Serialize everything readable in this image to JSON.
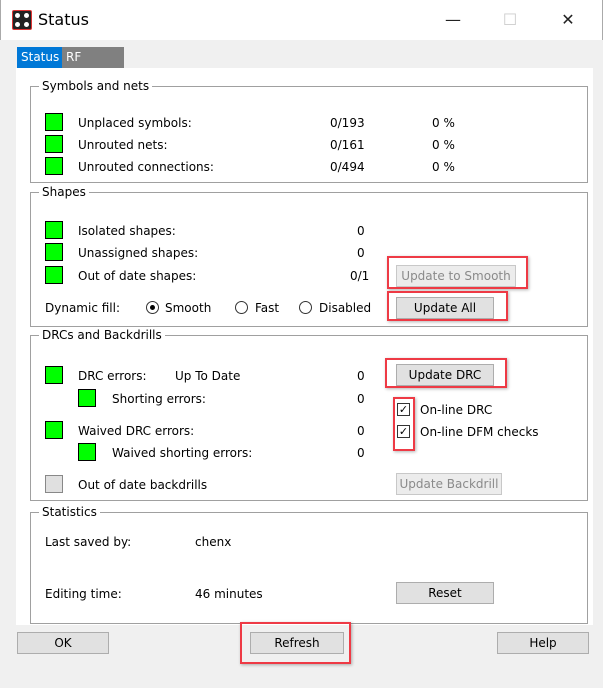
{
  "window": {
    "title": "Status",
    "icon": "pcb-app-icon",
    "minimize": "—",
    "maximize": "☐",
    "close": "✕"
  },
  "tabs": [
    {
      "label": "Status",
      "active": true
    },
    {
      "label": "RF Status",
      "active": false
    }
  ],
  "symbols_nets": {
    "title": "Symbols and nets",
    "rows": [
      {
        "label": "Unplaced symbols:",
        "value": "0/193",
        "percent": "0 %",
        "status": "#00ff00"
      },
      {
        "label": "Unrouted nets:",
        "value": "0/161",
        "percent": "0 %",
        "status": "#00ff00"
      },
      {
        "label": "Unrouted connections:",
        "value": "0/494",
        "percent": "0 %",
        "status": "#00ff00"
      }
    ]
  },
  "shapes": {
    "title": "Shapes",
    "rows": [
      {
        "label": "Isolated shapes:",
        "value": "0"
      },
      {
        "label": "Unassigned shapes:",
        "value": "0"
      },
      {
        "label": "Out of date shapes:",
        "value": "0/1"
      }
    ],
    "update_smooth": "Update to Smooth",
    "update_all": "Update All",
    "dynamic_fill_label": "Dynamic fill:",
    "fill_options": [
      "Smooth",
      "Fast",
      "Disabled"
    ],
    "fill_selected": "Smooth"
  },
  "drc": {
    "title": "DRCs and Backdrills",
    "drc_errors": {
      "label": "DRC errors:",
      "state": "Up To Date",
      "value": "0"
    },
    "shorting": {
      "label": "Shorting errors:",
      "value": "0"
    },
    "waived": {
      "label": "Waived DRC errors:",
      "value": "0"
    },
    "waived_shorting": {
      "label": "Waived shorting errors:",
      "value": "0"
    },
    "backdrills": {
      "label": "Out of date backdrills"
    },
    "update_drc": "Update DRC",
    "online_drc": "On-line DRC",
    "online_dfm": "On-line DFM checks",
    "online_drc_checked": true,
    "online_dfm_checked": true,
    "update_backdrill": "Update Backdrill"
  },
  "statistics": {
    "title": "Statistics",
    "last_saved_label": "Last saved by:",
    "last_saved_value": "chenx",
    "editing_label": "Editing time:",
    "editing_value": "46 minutes",
    "reset": "Reset"
  },
  "footer": {
    "ok": "OK",
    "refresh": "Refresh",
    "help": "Help"
  },
  "colors": {
    "accent": "#0078d7",
    "ok_status": "#00ff00",
    "highlight": "#ee3a45"
  }
}
